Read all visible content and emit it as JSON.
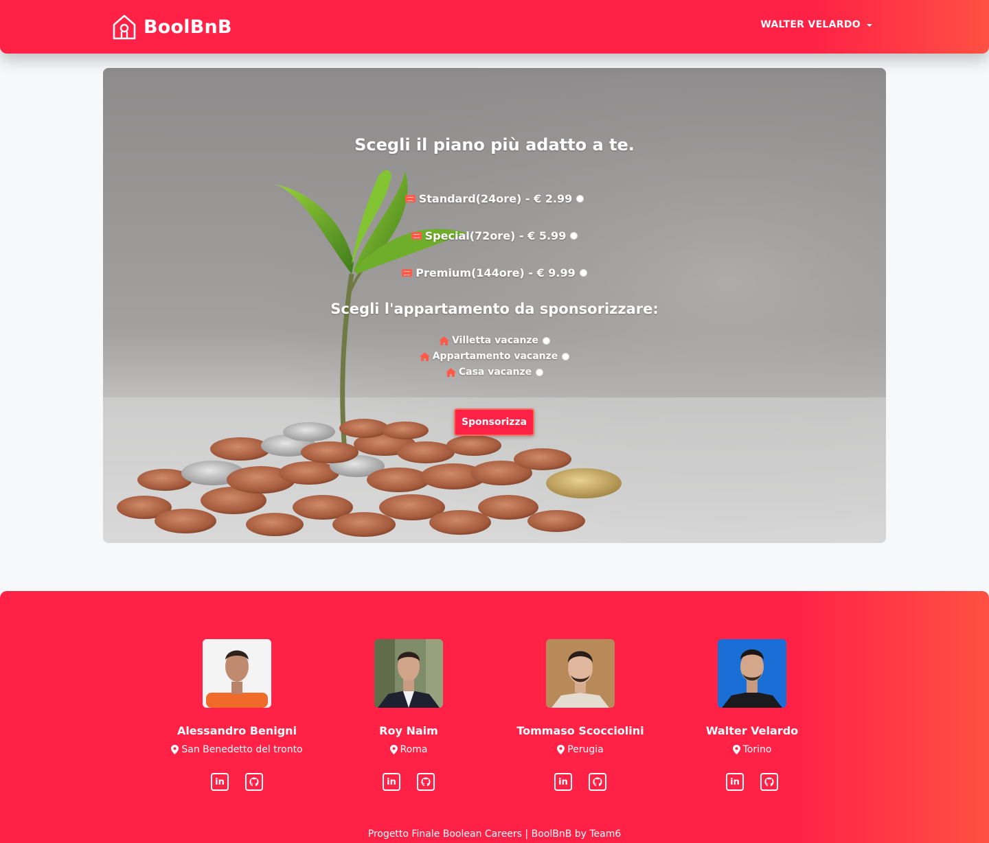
{
  "header": {
    "brand": "BoolBnB",
    "user_name": "WALTER VELARDO"
  },
  "hero": {
    "title": "Scegli il piano più adatto a te.",
    "plans": [
      {
        "label": "Standard(24ore) - € 2.99"
      },
      {
        "label": "Special(72ore) - € 5.99"
      },
      {
        "label": "Premium(144ore) - € 9.99"
      }
    ],
    "apartments_title": "Scegli l'appartamento da sponsorizzare:",
    "apartments": [
      {
        "label": "Villetta vacanze"
      },
      {
        "label": "Appartamento vacanze"
      },
      {
        "label": "Casa vacanze"
      }
    ],
    "submit_label": "Sponsorizza"
  },
  "footer": {
    "members": [
      {
        "name": "Alessandro Benigni",
        "city": "San Benedetto del tronto"
      },
      {
        "name": "Roy Naim",
        "city": "Roma"
      },
      {
        "name": "Tommaso Scocciolini",
        "city": "Perugia"
      },
      {
        "name": "Walter Velardo",
        "city": "Torino"
      }
    ],
    "note": "Progetto Finale Boolean Careers | BoolBnB by Team6"
  },
  "colors": {
    "brand": "#ff2146",
    "accent": "#ff5a4a"
  },
  "icons": [
    "house-logo-icon",
    "chevron-down-icon",
    "ticket-icon",
    "home-icon",
    "map-pin-icon",
    "linkedin-icon",
    "github-icon"
  ]
}
